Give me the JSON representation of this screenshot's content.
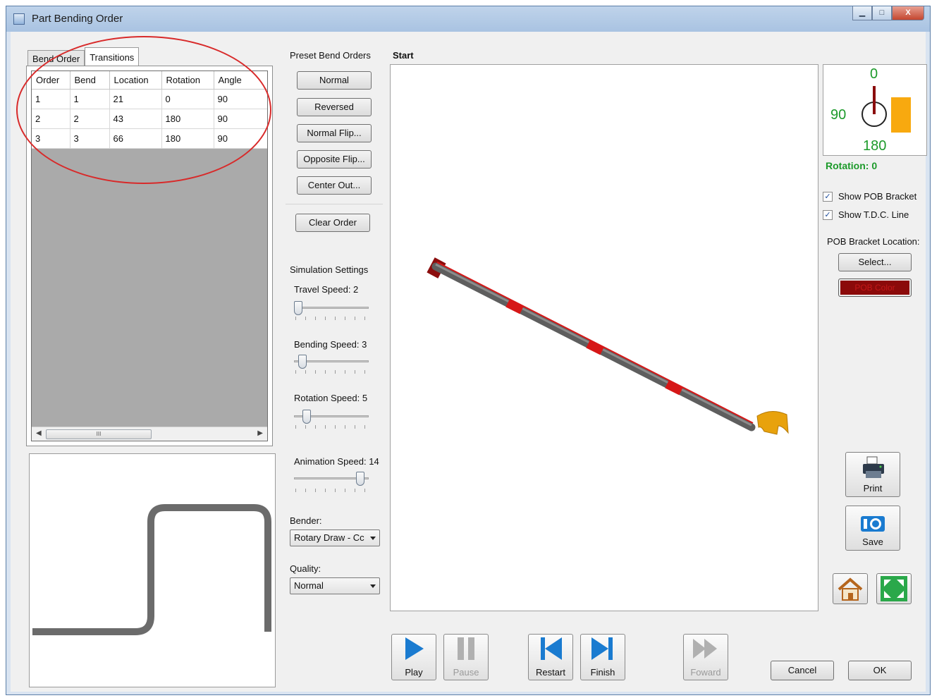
{
  "window": {
    "title": "Part Bending Order",
    "minimize": "▁",
    "maximize": "□",
    "close": "X"
  },
  "tabs": [
    {
      "label": "Bend Order"
    },
    {
      "label": "Transitions"
    }
  ],
  "bend_table": {
    "columns": [
      "Order",
      "Bend",
      "Location",
      "Rotation",
      "Angle"
    ],
    "rows": [
      [
        "1",
        "1",
        "21",
        "0",
        "90"
      ],
      [
        "2",
        "2",
        "43",
        "180",
        "90"
      ],
      [
        "3",
        "3",
        "66",
        "180",
        "90"
      ]
    ],
    "scroll_grip": "III"
  },
  "preset": {
    "label": "Preset Bend Orders",
    "buttons": [
      "Normal",
      "Reversed",
      "Normal Flip...",
      "Opposite Flip...",
      "Center Out..."
    ],
    "clear": "Clear Order"
  },
  "simulation": {
    "label": "Simulation Settings",
    "travel": {
      "label": "Travel Speed: 2",
      "value": 2
    },
    "bending": {
      "label": "Bending Speed: 3",
      "value": 3
    },
    "rotation": {
      "label": "Rotation Speed: 5",
      "value": 5
    },
    "animation": {
      "label": "Animation Speed: 14",
      "value": 14
    },
    "bender_label": "Bender:",
    "bender_value": "Rotary Draw - Cc",
    "quality_label": "Quality:",
    "quality_value": "Normal"
  },
  "viewport": {
    "label": "Start"
  },
  "dial": {
    "top": "0",
    "left": "90",
    "bottom": "180",
    "rotation_text": "Rotation: 0"
  },
  "options": {
    "show_pob_bracket": "Show POB Bracket",
    "show_tdc_line": "Show T.D.C. Line",
    "pob_location_label": "POB Bracket Location:",
    "select_button": "Select...",
    "pob_color_button": "POB Color"
  },
  "actions": {
    "print": "Print",
    "save": "Save"
  },
  "playback": {
    "play": "Play",
    "pause": "Pause",
    "restart": "Restart",
    "finish": "Finish",
    "forward": "Foward"
  },
  "dialog": {
    "cancel": "Cancel",
    "ok": "OK"
  },
  "colors": {
    "pipe": "#6b6b6b",
    "pipe_marker": "#d61717",
    "die": "#e8a20c",
    "pob_color": "#8b0a0a",
    "rotation_text": "#1c9a2a"
  },
  "icons": {
    "print": "printer-icon",
    "save": "camera-icon",
    "home": "home-icon",
    "fit": "fit-view-icon"
  }
}
